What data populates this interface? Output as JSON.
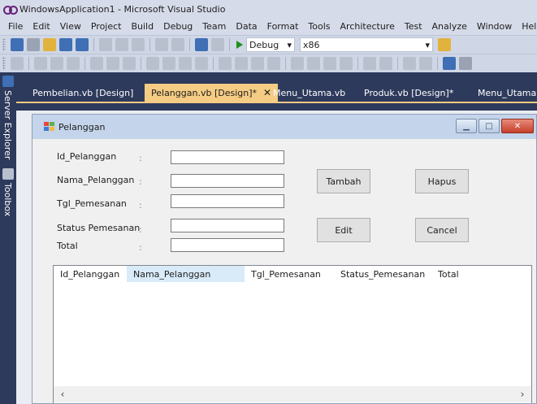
{
  "window": {
    "title": "WindowsApplication1 - Microsoft Visual Studio"
  },
  "menu": [
    "File",
    "Edit",
    "View",
    "Project",
    "Build",
    "Debug",
    "Team",
    "Data",
    "Format",
    "Tools",
    "Architecture",
    "Test",
    "Analyze",
    "Window",
    "Help"
  ],
  "toolbar": {
    "config_value": "Debug",
    "platform_value": "x86"
  },
  "left_dock": {
    "server_explorer": "Server Explorer",
    "toolbox": "Toolbox"
  },
  "tabs": [
    {
      "label": "Pembelian.vb [Design]",
      "active": false
    },
    {
      "label": "Pelanggan.vb [Design]*",
      "active": true
    },
    {
      "label": "Menu_Utama.vb",
      "active": false
    },
    {
      "label": "Produk.vb [Design]*",
      "active": false
    },
    {
      "label": "Menu_Utama.vb",
      "active": false
    }
  ],
  "form": {
    "title": "Pelanggan",
    "colon": ":",
    "fields": [
      {
        "label": "Id_Pelanggan",
        "value": ""
      },
      {
        "label": "Nama_Pelanggan",
        "value": ""
      },
      {
        "label": "Tgl_Pemesanan",
        "value": ""
      },
      {
        "label": "Status Pemesanan",
        "value": ""
      },
      {
        "label": "Total",
        "value": ""
      }
    ],
    "buttons": {
      "tambah": "Tambah",
      "hapus": "Hapus",
      "edit": "Edit",
      "cancel": "Cancel"
    },
    "list_columns": [
      "Id_Pelanggan",
      "Nama_Pelanggan",
      "Tgl_Pemesanan",
      "Status_Pemesanan",
      "Total"
    ]
  },
  "colors": {
    "accent_tab": "#f5cc84",
    "dock": "#2d3a5c",
    "close_button": "#c6402b"
  }
}
